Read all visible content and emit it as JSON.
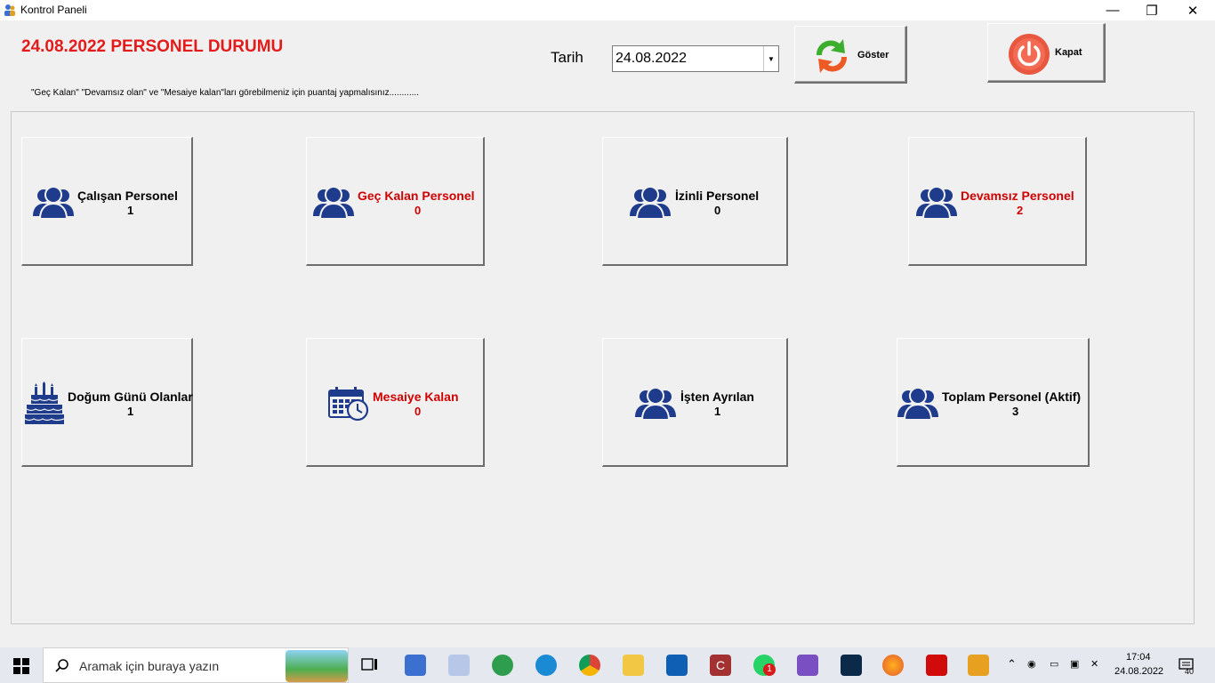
{
  "window": {
    "title": "Kontrol Paneli",
    "minimize": "—",
    "restore": "❐",
    "close": "✕"
  },
  "header": {
    "title": "24.08.2022 PERSONEL DURUMU",
    "date_label": "Tarih",
    "date_value": "24.08.2022",
    "show_button": "Göster",
    "close_button": "Kapat",
    "note": "\"Geç Kalan\" \"Devamsız olan\" ve \"Mesaiye kalan\"ları görebilmeniz için puantaj yapmalısınız............"
  },
  "cards": [
    {
      "title": "Çalışan Personel",
      "value": "1",
      "icon": "users-icon",
      "color": "black"
    },
    {
      "title": "Geç Kalan Personel",
      "value": "0",
      "icon": "users-icon",
      "color": "red"
    },
    {
      "title": "İzinli Personel",
      "value": "0",
      "icon": "users-icon",
      "color": "black"
    },
    {
      "title": "Devamsız Personel",
      "value": "2",
      "icon": "users-icon",
      "color": "red"
    },
    {
      "title": "Doğum Günü Olanlar",
      "value": "1",
      "icon": "birthday-cake-icon",
      "color": "black"
    },
    {
      "title": "Mesaiye Kalan",
      "value": "0",
      "icon": "calendar-clock-icon",
      "color": "red"
    },
    {
      "title": "İşten Ayrılan",
      "value": "1",
      "icon": "users-icon",
      "color": "black"
    },
    {
      "title": "Toplam Personel (Aktif)",
      "value": "3",
      "icon": "users-icon",
      "color": "black"
    }
  ],
  "taskbar": {
    "search_placeholder": "Aramak için buraya yazın",
    "time": "17:04",
    "date": "24.08.2022",
    "whatsapp_badge": "1",
    "notification_count": "40"
  },
  "colors": {
    "accent_red": "#e31b1b",
    "icon_blue": "#1f3b8c"
  }
}
